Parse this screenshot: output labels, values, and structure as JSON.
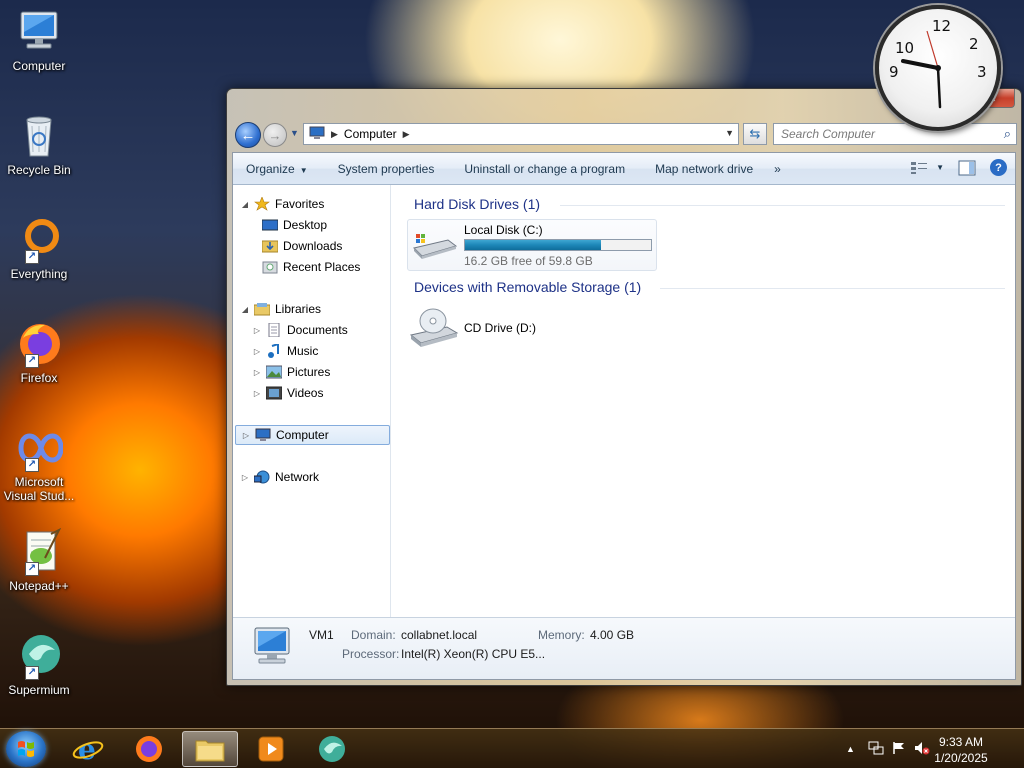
{
  "desktop": {
    "icons": [
      {
        "label": "Computer"
      },
      {
        "label": "Recycle Bin"
      },
      {
        "label": "Everything"
      },
      {
        "label": "Firefox"
      },
      {
        "label": "Microsoft Visual Stud..."
      },
      {
        "label": "Notepad++"
      },
      {
        "label": "Supermium"
      }
    ]
  },
  "clock_gadget": {
    "numbers": [
      "12",
      "2",
      "3",
      "9",
      "10"
    ]
  },
  "window": {
    "caption": {
      "minimize": "—",
      "maximize": "□",
      "close": "✕"
    },
    "address": {
      "segments": [
        "Computer"
      ]
    },
    "search": {
      "placeholder": "Search Computer"
    },
    "commandbar": {
      "organize": "Organize",
      "system_properties": "System properties",
      "uninstall": "Uninstall or change a program",
      "map_drive": "Map network drive",
      "more": "»",
      "help": "?"
    },
    "navpane": {
      "favorites": "Favorites",
      "desktop": "Desktop",
      "downloads": "Downloads",
      "recent": "Recent Places",
      "libraries": "Libraries",
      "documents": "Documents",
      "music": "Music",
      "pictures": "Pictures",
      "videos": "Videos",
      "computer": "Computer",
      "network": "Network"
    },
    "content": {
      "hdd_group": "Hard Disk Drives (1)",
      "removable_group": "Devices with Removable Storage (1)",
      "local_disk": {
        "name": "Local Disk (C:)",
        "free": "16.2 GB free of 59.8 GB",
        "used_fraction": 0.729
      },
      "cd_drive": {
        "name": "CD Drive (D:)"
      }
    },
    "details": {
      "name": "VM1",
      "domain_label": "Domain:",
      "domain_value": "collabnet.local",
      "memory_label": "Memory:",
      "memory_value": "4.00 GB",
      "processor_label": "Processor:",
      "processor_value": "Intel(R) Xeon(R) CPU E5..."
    }
  },
  "taskbar": {
    "time": "9:33 AM",
    "date": "1/20/2025",
    "tray_arrow": "▲"
  },
  "colors": {
    "accent_blue": "#1e3287",
    "bar_fill": "#1d87b8",
    "selection": "#dceaf8"
  }
}
